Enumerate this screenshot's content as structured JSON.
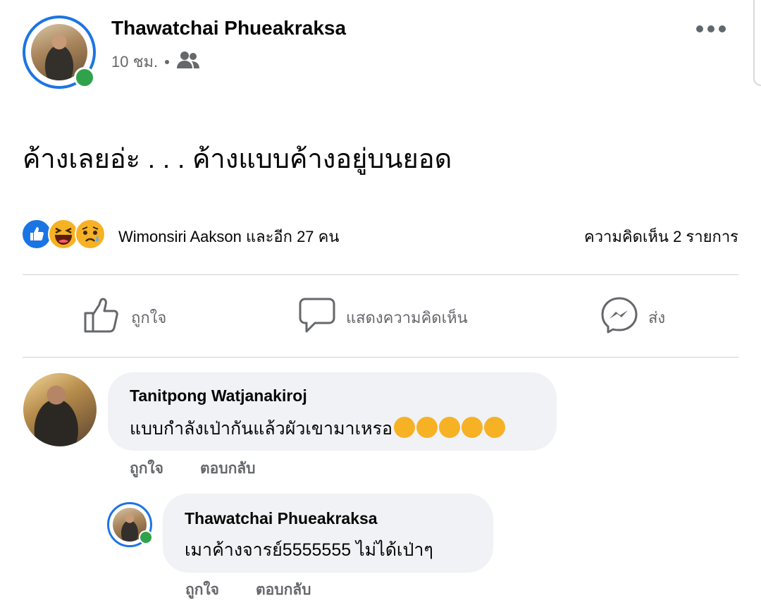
{
  "post": {
    "author": "Thawatchai Phueakraksa",
    "time": "10 ชม.",
    "audience_icon": "friends-icon",
    "text": "ค้างเลยอ่ะ . . . ค้างแบบค้างอยู่บนยอด",
    "reactions": {
      "types": [
        "like",
        "haha",
        "sad"
      ],
      "summary": "Wimonsiri Aakson และอีก 27 คน",
      "comment_count": "ความคิดเห็น 2 รายการ"
    },
    "actions": {
      "like": "ถูกใจ",
      "comment": "แสดงความคิดเห็น",
      "share": "ส่ง"
    }
  },
  "comments": [
    {
      "author": "Tanitpong Watjanakiroj",
      "text": "แบบกำลังเป่ากันแล้วผัวเขามาเหรอ",
      "emojis": [
        "rolling-laugh",
        "rolling-laugh",
        "rolling-laugh",
        "laughing",
        "laughing"
      ],
      "like": "ถูกใจ",
      "reply": "ตอบกลับ"
    },
    {
      "author": "Thawatchai Phueakraksa",
      "text": "เมาค้างจารย์5555555 ไม่ได้เป่าๆ",
      "like": "ถูกใจ",
      "reply": "ตอบกลับ"
    }
  ],
  "colors": {
    "brand_blue": "#1b74e4",
    "online_green": "#31a24c",
    "secondary_text": "#65676b",
    "bubble_bg": "#f0f2f5",
    "reaction_yellow": "#f7b125"
  }
}
